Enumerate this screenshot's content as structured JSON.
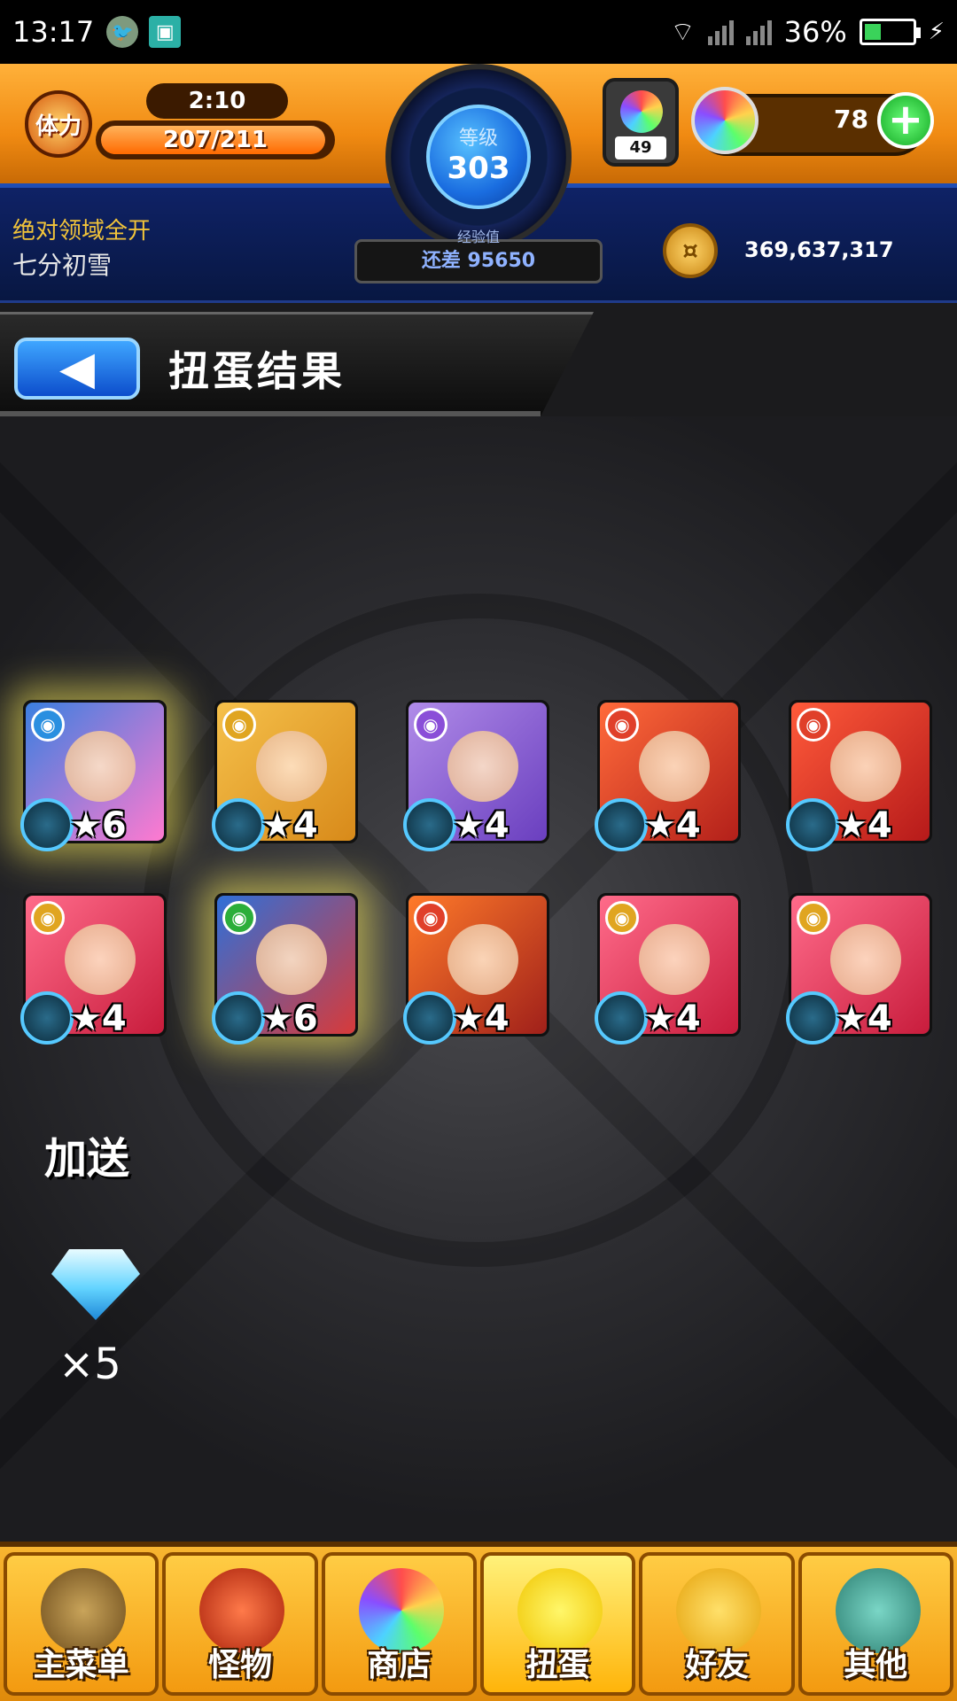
{
  "status_bar": {
    "time": "13:17",
    "battery": "36%"
  },
  "header": {
    "stamina_icon_text": "体力",
    "stamina_timer": "2:10",
    "stamina": "207/211",
    "stamina_fraction": 0.98,
    "level_label": "等级",
    "level": "303",
    "exp_label": "经验值",
    "exp_remaining": "还差 95650",
    "orb_case_count": "49",
    "orb_count": "78",
    "clan": "绝对领域全开",
    "player_name": "七分初雪",
    "coins": "369,637,317"
  },
  "page": {
    "title": "扭蛋结果"
  },
  "results": [
    {
      "stars": "★6",
      "element": "water",
      "colors": [
        "#3b7fe0",
        "#ff7ad0"
      ],
      "glow": true
    },
    {
      "stars": "★4",
      "element": "light",
      "colors": [
        "#f5c04a",
        "#d88a1a"
      ],
      "glow": false
    },
    {
      "stars": "★4",
      "element": "dark",
      "colors": [
        "#b08be8",
        "#6a3fbf"
      ],
      "glow": false
    },
    {
      "stars": "★4",
      "element": "fire",
      "colors": [
        "#ff6a3a",
        "#b3201a"
      ],
      "glow": false
    },
    {
      "stars": "★4",
      "element": "fire",
      "colors": [
        "#ff5a3a",
        "#b61a1a"
      ],
      "glow": false
    },
    {
      "stars": "★4",
      "element": "light",
      "colors": [
        "#ff6b8a",
        "#c81c3c"
      ],
      "glow": false
    },
    {
      "stars": "★6",
      "element": "wood",
      "colors": [
        "#2f6fd8",
        "#d83a3a"
      ],
      "glow": true
    },
    {
      "stars": "★4",
      "element": "fire",
      "colors": [
        "#ff7a2a",
        "#a0201a"
      ],
      "glow": false
    },
    {
      "stars": "★4",
      "element": "light",
      "colors": [
        "#ff6b8a",
        "#c81c3c"
      ],
      "glow": false
    },
    {
      "stars": "★4",
      "element": "light",
      "colors": [
        "#ff6b8a",
        "#c81c3c"
      ],
      "glow": false
    }
  ],
  "bonus": {
    "label": "加送",
    "quantity": "×5",
    "item_icon": "diamond-icon"
  },
  "bottom_nav": [
    {
      "label": "主菜单",
      "icon": "home-gate-icon"
    },
    {
      "label": "怪物",
      "icon": "monster-icon"
    },
    {
      "label": "商店",
      "icon": "orb-shop-icon"
    },
    {
      "label": "扭蛋",
      "icon": "gacha-egg-icon",
      "active": true
    },
    {
      "label": "好友",
      "icon": "friends-icon"
    },
    {
      "label": "其他",
      "icon": "other-icon"
    }
  ],
  "colors": {
    "water": "#2a8fe0",
    "light": "#e0a520",
    "dark": "#8a4ed8",
    "fire": "#e0402a",
    "wood": "#2cae3a"
  }
}
